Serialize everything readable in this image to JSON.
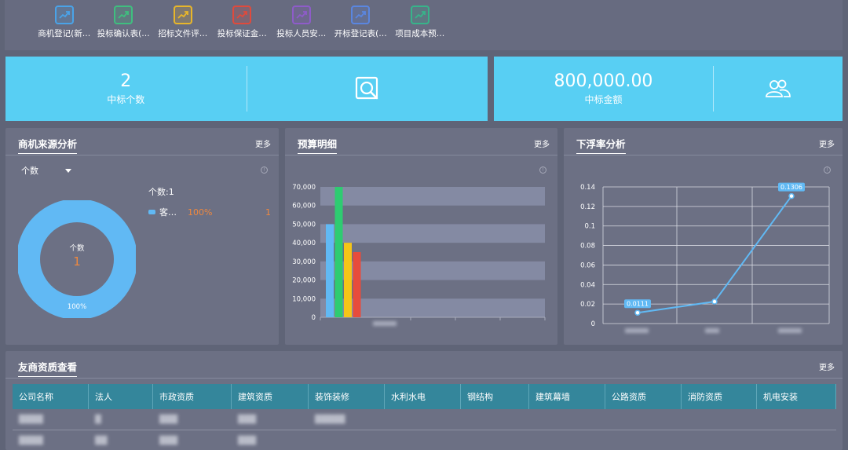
{
  "shortcuts": [
    {
      "label": "商机登记(新…",
      "color": "#4aa3e8"
    },
    {
      "label": "投标确认表(…",
      "color": "#3fbf7f"
    },
    {
      "label": "招标文件评…",
      "color": "#e8b62a"
    },
    {
      "label": "投标保证金…",
      "color": "#e04a3c"
    },
    {
      "label": "投标人员安…",
      "color": "#8e5cc9"
    },
    {
      "label": "开标登记表(…",
      "color": "#5a86e0"
    },
    {
      "label": "项目成本预…",
      "color": "#37b48a"
    }
  ],
  "kpi": {
    "won_count": {
      "value": "2",
      "caption": "中标个数"
    },
    "won_amount": {
      "value": "800,000.00",
      "caption": "中标金额"
    }
  },
  "panels": {
    "source": {
      "title": "商机来源分析",
      "more": "更多",
      "selector": "个数",
      "legend_header": "个数:1",
      "legend_name": "客…",
      "legend_pct": "100%",
      "legend_count": "1",
      "donut_center_label": "个数",
      "donut_center_value": "1",
      "donut_pct": "100%"
    },
    "budget": {
      "title": "预算明细",
      "more": "更多"
    },
    "float": {
      "title": "下浮率分析",
      "more": "更多"
    },
    "rivals": {
      "title": "友商资质查看",
      "more": "更多"
    }
  },
  "chart_data": [
    {
      "type": "pie",
      "values": [
        1
      ],
      "percent_labels": [
        "100%"
      ],
      "colors": [
        "#61b9f4"
      ]
    },
    {
      "type": "bar",
      "ylim": [
        0,
        70000
      ],
      "yticks": [
        "0",
        "10,000",
        "20,000",
        "30,000",
        "40,000",
        "50,000",
        "60,000",
        "70,000"
      ],
      "series": [
        {
          "values": [
            50000
          ],
          "color": "#61b9f4"
        },
        {
          "values": [
            70000
          ],
          "color": "#2ecc71"
        },
        {
          "values": [
            40000
          ],
          "color": "#f5c518"
        },
        {
          "values": [
            35000
          ],
          "color": "#e74c3c"
        }
      ]
    },
    {
      "type": "line",
      "ylim": [
        0,
        0.14
      ],
      "yticks": [
        "0",
        "0.02",
        "0.04",
        "0.06",
        "0.08",
        "0.1",
        "0.12",
        "0.14"
      ],
      "values": [
        0.0111,
        0.0225,
        0.1306
      ],
      "point_labels": [
        "0.0111",
        "",
        "0.1306"
      ],
      "color": "#61b9f4"
    }
  ],
  "table": {
    "columns": [
      "公司名称",
      "法人",
      "市政资质",
      "建筑资质",
      "装饰装修",
      "水利水电",
      "钢结构",
      "建筑幕墙",
      "公路资质",
      "消防资质",
      "机电安装"
    ]
  },
  "colors": {
    "kpi": "#58cff3",
    "panel": "#6c7084",
    "background": "#5f6477",
    "table_head": "#34869b"
  }
}
